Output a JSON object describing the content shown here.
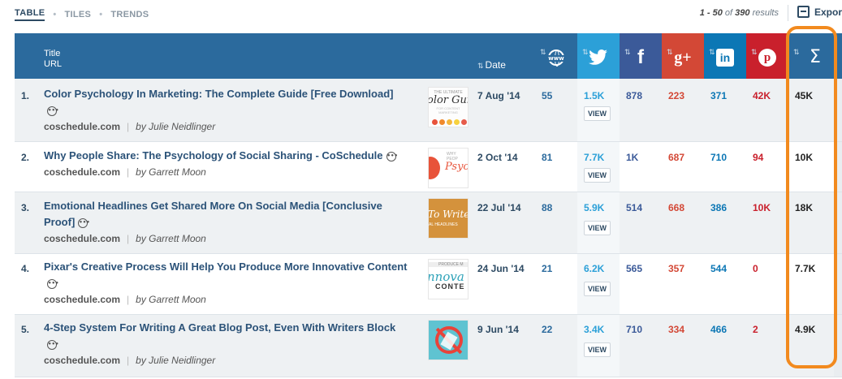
{
  "views": {
    "tabs": [
      {
        "label": "TABLE",
        "active": true
      },
      {
        "label": "TILES",
        "active": false
      },
      {
        "label": "TRENDS",
        "active": false
      }
    ],
    "separator": "•"
  },
  "results": {
    "range": "1 - 50",
    "of": "of",
    "total": "390",
    "suffix": "results"
  },
  "export": {
    "label": "Expor",
    "icon": "export-icon"
  },
  "table": {
    "header": {
      "title": "Title",
      "url": "URL",
      "date": "Date",
      "sort_glyph": "⇅",
      "networks": [
        {
          "key": "web",
          "icon": "web-icon"
        },
        {
          "key": "twitter",
          "icon": "twitter-icon"
        },
        {
          "key": "facebook",
          "icon": "facebook-icon"
        },
        {
          "key": "googleplus",
          "icon": "googleplus-icon"
        },
        {
          "key": "linkedin",
          "icon": "linkedin-icon"
        },
        {
          "key": "pinterest",
          "icon": "pinterest-icon"
        },
        {
          "key": "total",
          "icon": "sigma-icon"
        }
      ]
    },
    "rows": [
      {
        "num": "1.",
        "title": "Color Psychology In Marketing: The Complete Guide [Free Download]",
        "domain": "coschedule.com",
        "author": "by Julie Neidlinger",
        "thumb_text": "olor Guid",
        "date": "7 Aug '14",
        "web": "55",
        "twitter": "1.5K",
        "view": "VIEW",
        "facebook": "878",
        "googleplus": "223",
        "linkedin": "371",
        "pinterest": "42K",
        "total": "45K"
      },
      {
        "num": "2.",
        "title": "Why People Share: The Psychology of Social Sharing - CoSchedule",
        "domain": "coschedule.com",
        "author": "by Garrett Moon",
        "thumb_text": "Psych",
        "date": "2 Oct '14",
        "web": "81",
        "twitter": "7.7K",
        "view": "VIEW",
        "facebook": "1K",
        "googleplus": "687",
        "linkedin": "710",
        "pinterest": "94",
        "total": "10K"
      },
      {
        "num": "3.",
        "title": "Emotional Headlines Get Shared More On Social Media [Conclusive Proof]",
        "domain": "coschedule.com",
        "author": "by Garrett Moon",
        "thumb_text": "To Write",
        "date": "22 Jul '14",
        "web": "88",
        "twitter": "5.9K",
        "view": "VIEW",
        "facebook": "514",
        "googleplus": "668",
        "linkedin": "386",
        "pinterest": "10K",
        "total": "18K"
      },
      {
        "num": "4.",
        "title": "Pixar's Creative Process Will Help You Produce More Innovative Content",
        "domain": "coschedule.com",
        "author": "by Garrett Moon",
        "thumb_text": "nnova",
        "date": "24 Jun '14",
        "web": "21",
        "twitter": "6.2K",
        "view": "VIEW",
        "facebook": "565",
        "googleplus": "357",
        "linkedin": "544",
        "pinterest": "0",
        "total": "7.7K"
      },
      {
        "num": "5.",
        "title": "4-Step System For Writing A Great Blog Post, Even With Writers Block",
        "domain": "coschedule.com",
        "author": "by Julie Neidlinger",
        "thumb_text": "",
        "date": "9 Jun '14",
        "web": "22",
        "twitter": "3.4K",
        "view": "VIEW",
        "facebook": "710",
        "googleplus": "334",
        "linkedin": "466",
        "pinterest": "2",
        "total": "4.9K"
      }
    ]
  },
  "colors": {
    "header": "#2b6a9d",
    "twitter": "#2ca0d8",
    "facebook": "#3b5a99",
    "googleplus": "#d34836",
    "linkedin": "#0c77b5",
    "pinterest": "#c9202c",
    "highlight": "#f28a1e"
  }
}
